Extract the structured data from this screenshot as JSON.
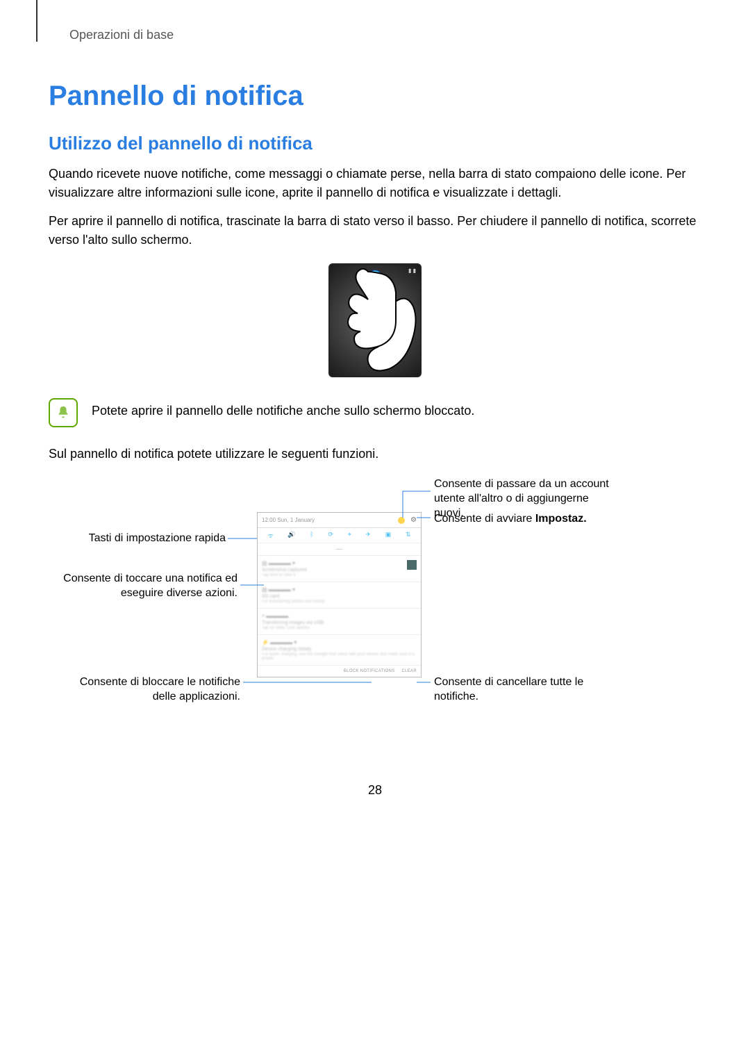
{
  "header": {
    "section": "Operazioni di base"
  },
  "h1": "Pannello di notifica",
  "h2": "Utilizzo del pannello di notifica",
  "para1": "Quando ricevete nuove notifiche, come messaggi o chiamate perse, nella barra di stato compaiono delle icone. Per visualizzare altre informazioni sulle icone, aprite il pannello di notifica e visualizzate i dettagli.",
  "para2": "Per aprire il pannello di notifica, trascinate la barra di stato verso il basso. Per chiudere il pannello di notifica, scorrete verso l'alto sullo schermo.",
  "note_text": "Potete aprire il pannello delle notifiche anche sullo schermo bloccato.",
  "para3": "Sul pannello di notifica potete utilizzare le seguenti funzioni.",
  "callouts": {
    "left1": "Tasti di impostazione rapida",
    "left2": "Consente di toccare una notifica ed eseguire diverse azioni.",
    "left3": "Consente di bloccare le notifiche delle applicazioni.",
    "right1": "Consente di passare da un account utente all'altro o di aggiungerne nuovi.",
    "right2_a": "Consente di avviare ",
    "right2_b": "Impostaz.",
    "right3": "Consente di cancellare tutte le notifiche."
  },
  "panel": {
    "time": "12:00   Sun, 1 January",
    "footer_block": "BLOCK NOTIFICATIONS",
    "footer_clear": "CLEAR"
  },
  "page_number": "28"
}
